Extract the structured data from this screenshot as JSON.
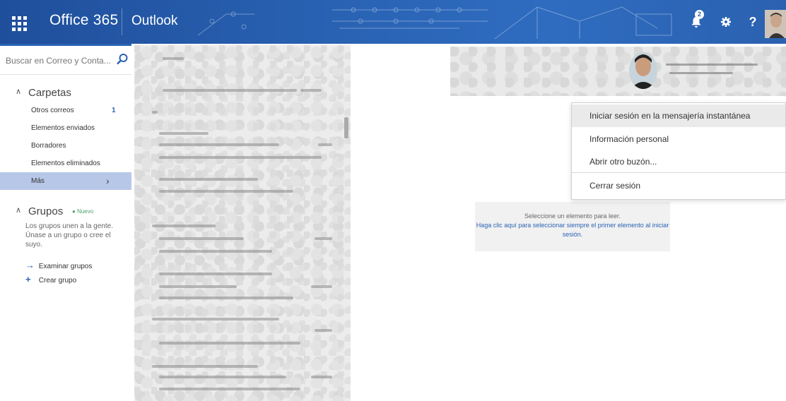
{
  "topbar": {
    "brand": "Office 365",
    "app": "Outlook",
    "notification_count": "2",
    "help_label": "?"
  },
  "search": {
    "placeholder": "Buscar en Correo y Conta..."
  },
  "folders_section": {
    "title": "Carpetas",
    "items": [
      {
        "label": "Otros correos",
        "count": "1"
      },
      {
        "label": "Elementos enviados"
      },
      {
        "label": "Borradores"
      },
      {
        "label": "Elementos eliminados"
      },
      {
        "label": "Más"
      }
    ]
  },
  "groups_section": {
    "title": "Grupos",
    "badge": "Nuevo",
    "description": "Los grupos unen a la gente. Únase a un grupo o cree el suyo.",
    "links": [
      {
        "label": "Examinar grupos",
        "icon": "arrow-right-icon"
      },
      {
        "label": "Crear grupo",
        "icon": "plus-icon"
      }
    ]
  },
  "reading_pane": {
    "message": "Seleccione un elemento para leer.",
    "link": "Haga clic aquí para seleccionar siempre el primer elemento al iniciar sesión."
  },
  "account_menu": {
    "items": [
      {
        "label": "Iniciar sesión en la mensajería instantánea"
      },
      {
        "label": "Información personal"
      },
      {
        "label": "Abrir otro buzón..."
      },
      {
        "label": "Cerrar sesión"
      }
    ]
  },
  "colors": {
    "accent": "#2a63b4",
    "topbar": "#1f4f9c",
    "selected_folder": "#b7c7e8",
    "new_badge": "#4aa36b"
  }
}
